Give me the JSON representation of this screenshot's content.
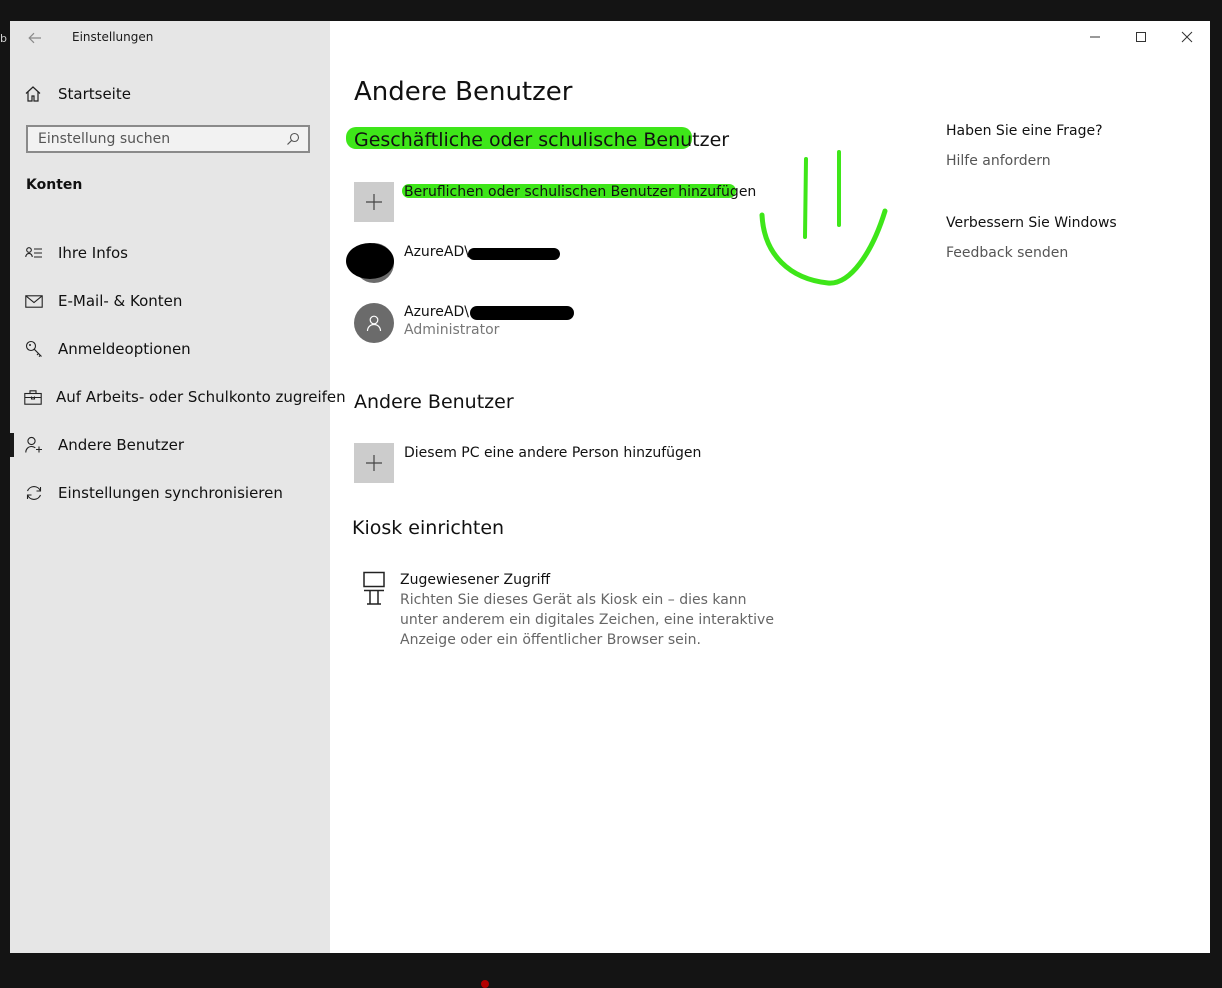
{
  "edge_char": "b",
  "app": {
    "title": "Einstellungen"
  },
  "sidebar": {
    "home_label": "Startseite",
    "search": {
      "placeholder": "Einstellung suchen",
      "value": ""
    },
    "section_title": "Konten",
    "items": [
      {
        "label": "Ihre Infos",
        "icon": "contact-card-icon",
        "active": false
      },
      {
        "label": "E-Mail- & Konten",
        "icon": "mail-icon",
        "active": false
      },
      {
        "label": "Anmeldeoptionen",
        "icon": "key-icon",
        "active": false
      },
      {
        "label": "Auf Arbeits- oder Schulkonto zugreifen",
        "icon": "briefcase-icon",
        "active": false
      },
      {
        "label": "Andere Benutzer",
        "icon": "add-person-icon",
        "active": true
      },
      {
        "label": "Einstellungen synchronisieren",
        "icon": "sync-icon",
        "active": false
      }
    ]
  },
  "main": {
    "page_title": "Andere Benutzer",
    "work_section": {
      "title": "Geschäftliche oder schulische Benutzer",
      "add_label": "Beruflichen oder schulischen Benutzer hinzufügen",
      "users": [
        {
          "name": "AzureAD\\",
          "role": ""
        },
        {
          "name": "AzureAD\\",
          "role": "Administrator"
        }
      ]
    },
    "other_section": {
      "title": "Andere Benutzer",
      "add_label": "Diesem PC eine andere Person hinzufügen"
    },
    "kiosk_section": {
      "title": "Kiosk einrichten",
      "item_title": "Zugewiesener Zugriff",
      "item_description": "Richten Sie dieses Gerät als Kiosk ein – dies kann unter anderem ein digitales Zeichen, eine interaktive Anzeige oder ein öffentlicher Browser sein."
    },
    "help": {
      "question_title": "Haben Sie eine Frage?",
      "question_link": "Hilfe anfordern",
      "improve_title": "Verbessern Sie Windows",
      "improve_link": "Feedback senden"
    }
  },
  "colors": {
    "sidebar_bg": "#e6e6e6",
    "highlight": "#3ee619",
    "avatar": "#6b6b6b",
    "tile": "#cccccc"
  }
}
